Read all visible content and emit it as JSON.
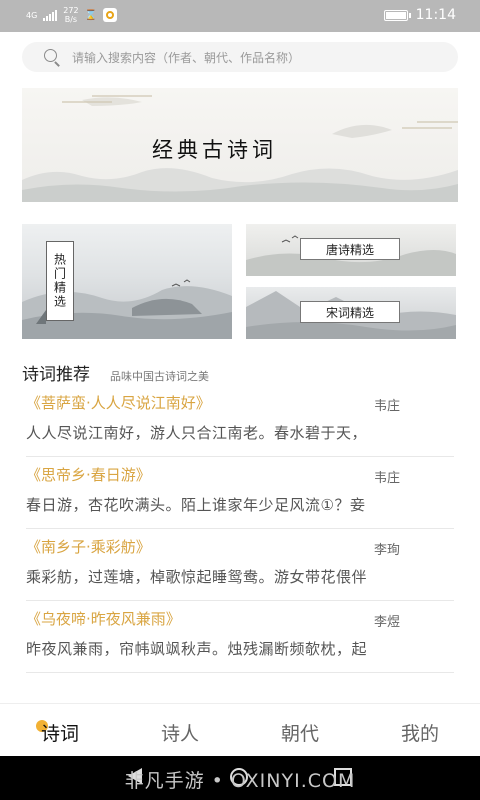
{
  "status_bar": {
    "network": "4G",
    "speed_value": "272",
    "speed_unit": "B/s",
    "time": "11:14",
    "icons": [
      "signal-icon",
      "notification-icon",
      "app-icon",
      "battery-icon"
    ]
  },
  "search": {
    "placeholder": "请输入搜索内容（作者、朝代、作品名称）"
  },
  "banner": {
    "title": "经典古诗词"
  },
  "categories": {
    "hot": "热门精选",
    "tang": "唐诗精选",
    "song": "宋词精选"
  },
  "section": {
    "title": "诗词推荐",
    "subtitle": "品味中国古诗词之美"
  },
  "poems": [
    {
      "title": "《菩萨蛮·人人尽说江南好》",
      "author": "韦庄",
      "excerpt": "人人尽说江南好，游人只合江南老。春水碧于天，"
    },
    {
      "title": "《思帝乡·春日游》",
      "author": "韦庄",
      "excerpt": "春日游，杏花吹满头。陌上谁家年少足风流①？妾"
    },
    {
      "title": "《南乡子·乘彩舫》",
      "author": "李珣",
      "excerpt": "乘彩舫，过莲塘，棹歌惊起睡鸳鸯。游女带花偎伴"
    },
    {
      "title": "《乌夜啼·昨夜风兼雨》",
      "author": "李煜",
      "excerpt": "昨夜风兼雨，帘帏飒飒秋声。烛残漏断频欹枕，起"
    }
  ],
  "tabs": [
    {
      "label": "诗词",
      "active": true
    },
    {
      "label": "诗人",
      "active": false
    },
    {
      "label": "朝代",
      "active": false
    },
    {
      "label": "我的",
      "active": false
    }
  ],
  "watermark": "非凡手游 • OXINYI.COM",
  "colors": {
    "accent": "#d9a542",
    "tab_dot": "#f2b134",
    "status_bar": "#b8b8b8"
  }
}
